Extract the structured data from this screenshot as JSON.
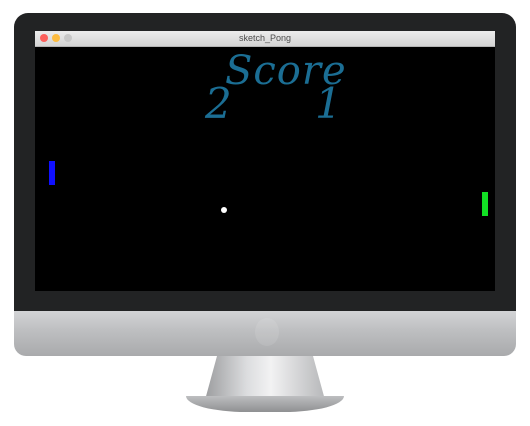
{
  "window": {
    "title": "sketch_Pong"
  },
  "game": {
    "score_label": "Score",
    "score_left": "2",
    "score_right": "1",
    "colors": {
      "score_text": "#1b6e94",
      "left_paddle": "#1010ff",
      "right_paddle": "#12e024",
      "ball": "#ffffff",
      "background": "#000000"
    }
  }
}
